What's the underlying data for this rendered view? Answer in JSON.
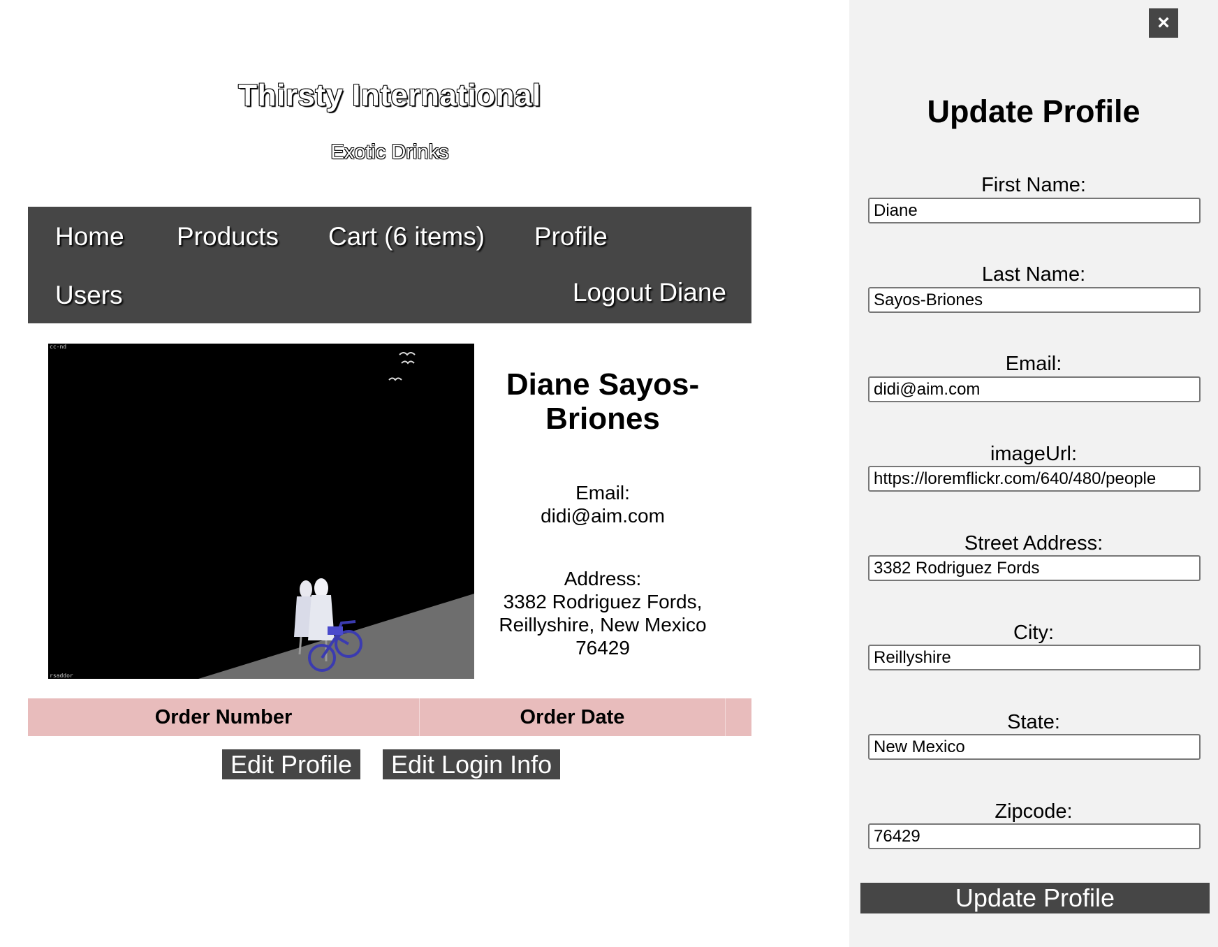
{
  "header": {
    "title": "Thirsty International",
    "subtitle": "Exotic Drinks"
  },
  "nav": {
    "home": "Home",
    "products": "Products",
    "cart": "Cart (6 items)",
    "profile": "Profile",
    "users": "Users",
    "logout": "Logout Diane"
  },
  "profile": {
    "image_corner_text_top": "cc-nd",
    "image_corner_text_bottom": "rsaddor",
    "name": "Diane Sayos-Briones",
    "email_label": "Email:",
    "email": "didi@aim.com",
    "address_label": "Address:",
    "address_line1": "3382 Rodriguez Fords,",
    "address_line2": "Reillyshire, New Mexico",
    "address_line3": "76429"
  },
  "orders": {
    "columns": [
      "Order Number",
      "Order Date"
    ]
  },
  "actions": {
    "edit_profile": "Edit Profile",
    "edit_login": "Edit Login Info"
  },
  "panel": {
    "close_glyph": "×",
    "title": "Update Profile",
    "fields": [
      {
        "label": "First Name:",
        "value": "Diane"
      },
      {
        "label": "Last Name:",
        "value": "Sayos-Briones"
      },
      {
        "label": "Email:",
        "value": "didi@aim.com"
      },
      {
        "label": "imageUrl:",
        "value": "https://loremflickr.com/640/480/people"
      },
      {
        "label": "Street Address:",
        "value": "3382 Rodriguez Fords"
      },
      {
        "label": "City:",
        "value": "Reillyshire"
      },
      {
        "label": "State:",
        "value": "New Mexico"
      },
      {
        "label": "Zipcode:",
        "value": "76429"
      }
    ],
    "submit": "Update Profile"
  },
  "colors": {
    "nav_bg": "#464646",
    "orders_header_bg": "#e8bcbc",
    "panel_bg": "#f2f2f2"
  }
}
